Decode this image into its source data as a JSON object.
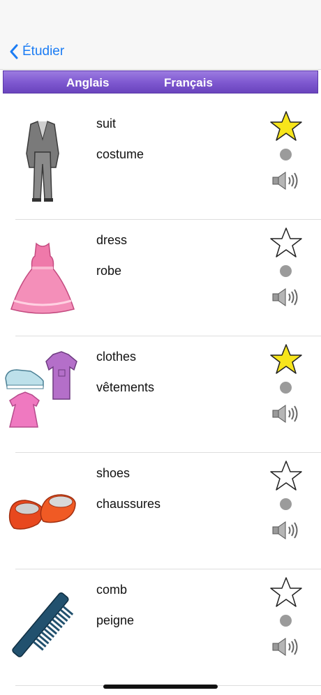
{
  "nav": {
    "back_label": "Étudier"
  },
  "header": {
    "col_english": "Anglais",
    "col_french": "Français"
  },
  "colors": {
    "accent": "#1b7cf4",
    "header_purple": "#7d57cf",
    "star_fill": "#f7e51b",
    "dot": "#9b9b9b"
  },
  "rows": [
    {
      "english": "suit",
      "french": "costume",
      "image_icon": "suit-icon",
      "favorite": true
    },
    {
      "english": "dress",
      "french": "robe",
      "image_icon": "dress-icon",
      "favorite": false
    },
    {
      "english": "clothes",
      "french": "vêtements",
      "image_icon": "clothes-icon",
      "favorite": true
    },
    {
      "english": "shoes",
      "french": "chaussures",
      "image_icon": "shoes-icon",
      "favorite": false
    },
    {
      "english": "comb",
      "french": "peigne",
      "image_icon": "comb-icon",
      "favorite": false
    }
  ]
}
